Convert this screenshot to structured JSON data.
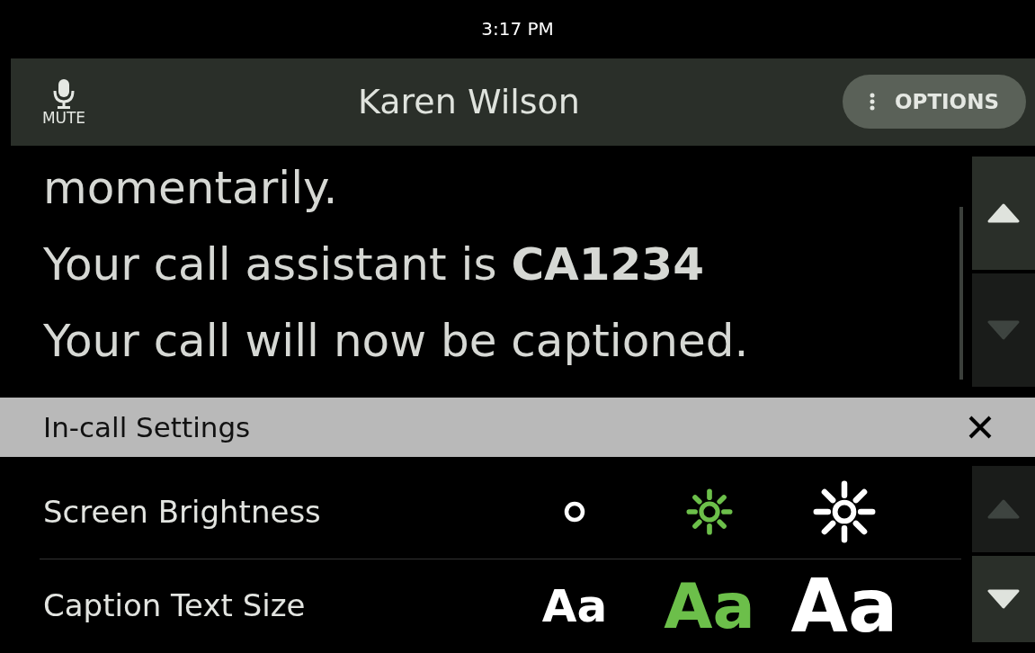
{
  "status_bar": {
    "time": "3:17 PM"
  },
  "header": {
    "mute_label": "MUTE",
    "caller": "Karen Wilson",
    "options_label": "OPTIONS"
  },
  "captions": {
    "lines": [
      {
        "text": "momentarily."
      },
      {
        "text": "Your call assistant is **CA1234**"
      },
      {
        "text": "Your call will now be captioned."
      }
    ],
    "scroll_up": {
      "disabled": false
    },
    "scroll_down": {
      "disabled": true
    }
  },
  "settings": {
    "title": "In-call Settings",
    "rows": [
      {
        "label": "Screen Brightness",
        "kind": "brightness",
        "options": [
          {
            "kind": "low",
            "selected": false
          },
          {
            "kind": "medium",
            "selected": true
          },
          {
            "kind": "high",
            "selected": false
          }
        ]
      },
      {
        "label": "Caption Text Size",
        "kind": "text_size",
        "options": [
          {
            "kind": "small",
            "text": "Aa",
            "selected": false
          },
          {
            "kind": "medium",
            "text": "Aa",
            "selected": true
          },
          {
            "kind": "large",
            "text": "Aa",
            "selected": false
          }
        ]
      }
    ],
    "scroll_up": {
      "disabled": true
    },
    "scroll_down": {
      "disabled": false
    }
  }
}
